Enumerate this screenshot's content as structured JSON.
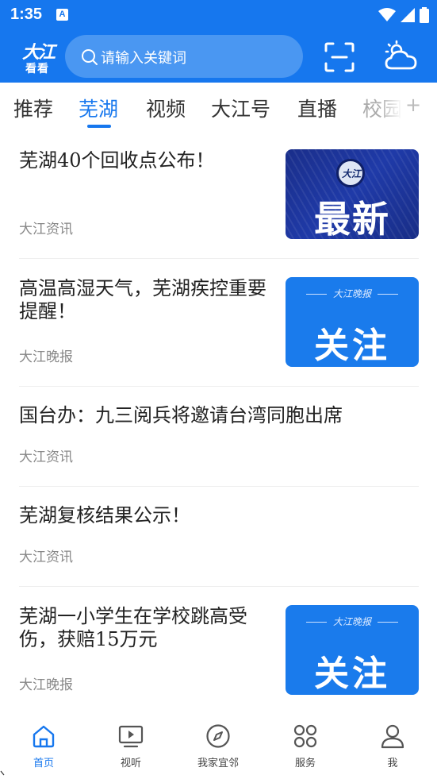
{
  "status": {
    "time": "1:35",
    "notif_letter": "A"
  },
  "header": {
    "logo_line1": "大江",
    "logo_line2": "看看",
    "search_placeholder": "请输入关键词"
  },
  "tabs": [
    {
      "label": "推荐"
    },
    {
      "label": "芜湖"
    },
    {
      "label": "视频"
    },
    {
      "label": "大江号"
    },
    {
      "label": "直播"
    },
    {
      "label": "校园"
    }
  ],
  "tab_more": "+",
  "news": [
    {
      "title": "芜湖40个回收点公布！",
      "source": "大江资讯",
      "thumb_text": "最新",
      "thumb_emblem": "大江"
    },
    {
      "title": "高温高湿天气，芜湖疾控重要提醒！",
      "source": "大江晚报",
      "thumb_text": "关注",
      "thumb_top": "大江晚报"
    },
    {
      "title": "国台办：九三阅兵将邀请台湾同胞出席",
      "source": "大江资讯"
    },
    {
      "title": "芜湖复核结果公示！",
      "source": "大江资讯"
    },
    {
      "title": "芜湖一小学生在学校跳高受伤，获赔15万元",
      "source": "大江晚报",
      "thumb_text": "关注",
      "thumb_top": "大江晚报"
    }
  ],
  "bottom_nav": [
    {
      "label": "首页",
      "icon": "home-icon"
    },
    {
      "label": "视听",
      "icon": "video-icon"
    },
    {
      "label": "我家宜邻",
      "icon": "compass-icon"
    },
    {
      "label": "服务",
      "icon": "grid-icon"
    },
    {
      "label": "我",
      "icon": "user-icon"
    }
  ],
  "colors": {
    "brand": "#1677ee",
    "text": "#222222",
    "muted": "#888888"
  }
}
